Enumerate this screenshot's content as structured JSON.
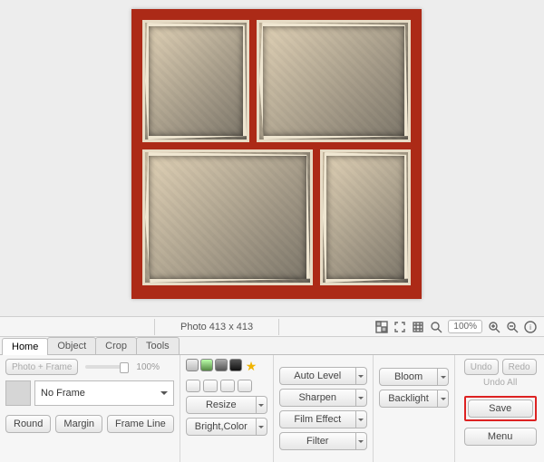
{
  "info": {
    "photo_size": "Photo 413 x 413",
    "zoom": "100%"
  },
  "tabs": [
    "Home",
    "Object",
    "Crop",
    "Tools"
  ],
  "home": {
    "mode_label": "Photo + Frame",
    "slider_pct": "100%",
    "frame_label": "No Frame",
    "round": "Round",
    "margin": "Margin",
    "frame_line": "Frame Line",
    "resize": "Resize",
    "bright_color": "Bright,Color"
  },
  "adjust": {
    "auto_level": "Auto Level",
    "sharpen": "Sharpen",
    "film_effect": "Film Effect",
    "filter": "Filter",
    "bloom": "Bloom",
    "backlight": "Backlight"
  },
  "side": {
    "undo": "Undo",
    "redo": "Redo",
    "undo_all": "Undo All",
    "save": "Save",
    "menu": "Menu"
  }
}
